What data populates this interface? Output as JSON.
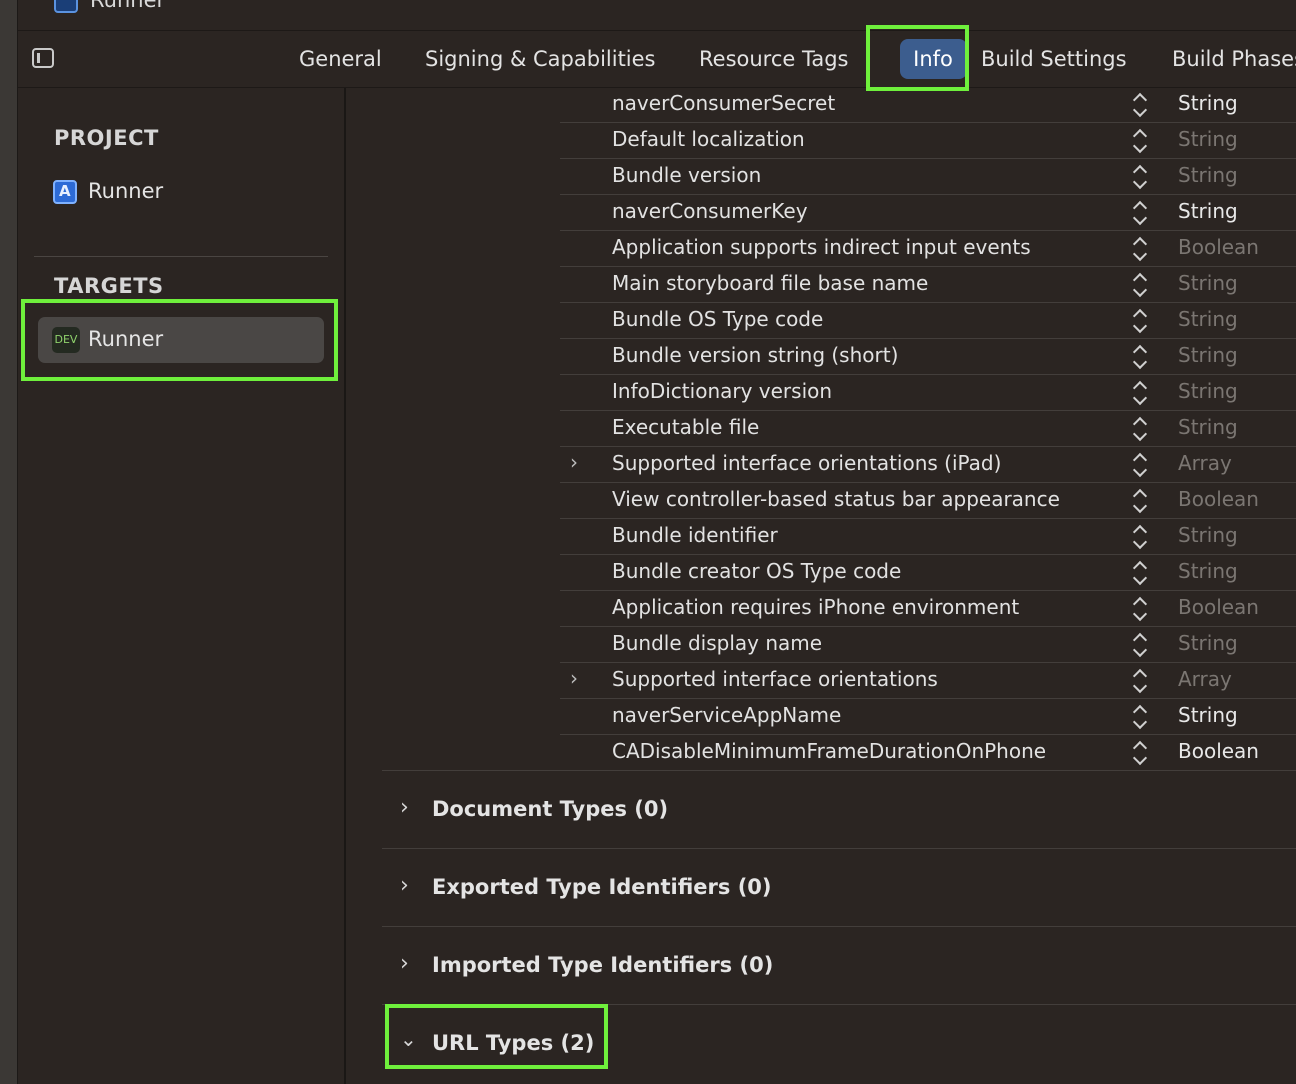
{
  "window": {
    "title": "Runner"
  },
  "tabs": [
    {
      "label": "General"
    },
    {
      "label": "Signing & Capabilities"
    },
    {
      "label": "Resource Tags"
    },
    {
      "label": "Info",
      "selected": true
    },
    {
      "label": "Build Settings"
    },
    {
      "label": "Build Phases"
    }
  ],
  "sidebar": {
    "project_title": "PROJECT",
    "project_item": "Runner",
    "targets_title": "TARGETS",
    "target_item": "Runner",
    "target_badge": "DEV"
  },
  "plist_rows": [
    {
      "key": "naverConsumerSecret",
      "type": "String",
      "dim": false,
      "expandable": false
    },
    {
      "key": "Default localization",
      "type": "String",
      "dim": true,
      "expandable": false
    },
    {
      "key": "Bundle version",
      "type": "String",
      "dim": true,
      "expandable": false
    },
    {
      "key": "naverConsumerKey",
      "type": "String",
      "dim": false,
      "expandable": false
    },
    {
      "key": "Application supports indirect input events",
      "type": "Boolean",
      "dim": true,
      "expandable": false
    },
    {
      "key": "Main storyboard file base name",
      "type": "String",
      "dim": true,
      "expandable": false
    },
    {
      "key": "Bundle OS Type code",
      "type": "String",
      "dim": true,
      "expandable": false
    },
    {
      "key": "Bundle version string (short)",
      "type": "String",
      "dim": true,
      "expandable": false
    },
    {
      "key": "InfoDictionary version",
      "type": "String",
      "dim": true,
      "expandable": false
    },
    {
      "key": "Executable file",
      "type": "String",
      "dim": true,
      "expandable": false
    },
    {
      "key": "Supported interface orientations (iPad)",
      "type": "Array",
      "dim": true,
      "expandable": true
    },
    {
      "key": "View controller-based status bar appearance",
      "type": "Boolean",
      "dim": true,
      "expandable": false
    },
    {
      "key": "Bundle identifier",
      "type": "String",
      "dim": true,
      "expandable": false
    },
    {
      "key": "Bundle creator OS Type code",
      "type": "String",
      "dim": true,
      "expandable": false
    },
    {
      "key": "Application requires iPhone environment",
      "type": "Boolean",
      "dim": true,
      "expandable": false
    },
    {
      "key": "Bundle display name",
      "type": "String",
      "dim": true,
      "expandable": false
    },
    {
      "key": "Supported interface orientations",
      "type": "Array",
      "dim": true,
      "expandable": true
    },
    {
      "key": "naverServiceAppName",
      "type": "String",
      "dim": false,
      "expandable": false
    },
    {
      "key": "CADisableMinimumFrameDurationOnPhone",
      "type": "Boolean",
      "dim": false,
      "expandable": false
    }
  ],
  "sections": [
    {
      "label": "Document Types (0)",
      "expanded": false
    },
    {
      "label": "Exported Type Identifiers (0)",
      "expanded": false
    },
    {
      "label": "Imported Type Identifiers (0)",
      "expanded": false
    },
    {
      "label": "URL Types (2)",
      "expanded": true
    }
  ],
  "colors": {
    "highlight": "#6ff03c",
    "selected_tab": "#3c5d8e",
    "background": "#2b2522"
  }
}
